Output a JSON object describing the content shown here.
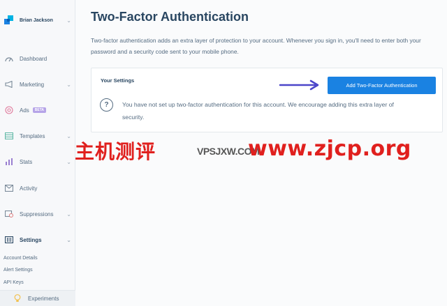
{
  "sidebar": {
    "account_name": "Brian Jackson",
    "items": [
      {
        "label": "Dashboard"
      },
      {
        "label": "Marketing"
      },
      {
        "label": "Ads",
        "badge": "BETA"
      },
      {
        "label": "Templates"
      },
      {
        "label": "Stats"
      },
      {
        "label": "Activity"
      },
      {
        "label": "Suppressions"
      },
      {
        "label": "Settings"
      }
    ],
    "subitems": [
      "Account Details",
      "Alert Settings",
      "API Keys"
    ],
    "experiments_label": "Experiments"
  },
  "main": {
    "title": "Two-Factor Authentication",
    "description": "Two-factor authentication adds an extra layer of protection to your account. Whenever you sign in, you'll need to enter both your password and a security code sent to your mobile phone.",
    "card": {
      "title": "Your Settings",
      "add_button_label": "Add Two-Factor Authentication",
      "message": "You have not set up two-factor authentication for this account. We encourage adding this extra layer of security."
    }
  },
  "watermark": {
    "cn_text": "主机测评",
    "url_text": "www.zjcp.org",
    "ghost_text": "VPSJXW.COM"
  },
  "colors": {
    "accent": "#1a82e2",
    "arrow": "#4b45c9",
    "watermark": "#e0201e",
    "text_primary": "#294661",
    "text_secondary": "#546b81"
  }
}
